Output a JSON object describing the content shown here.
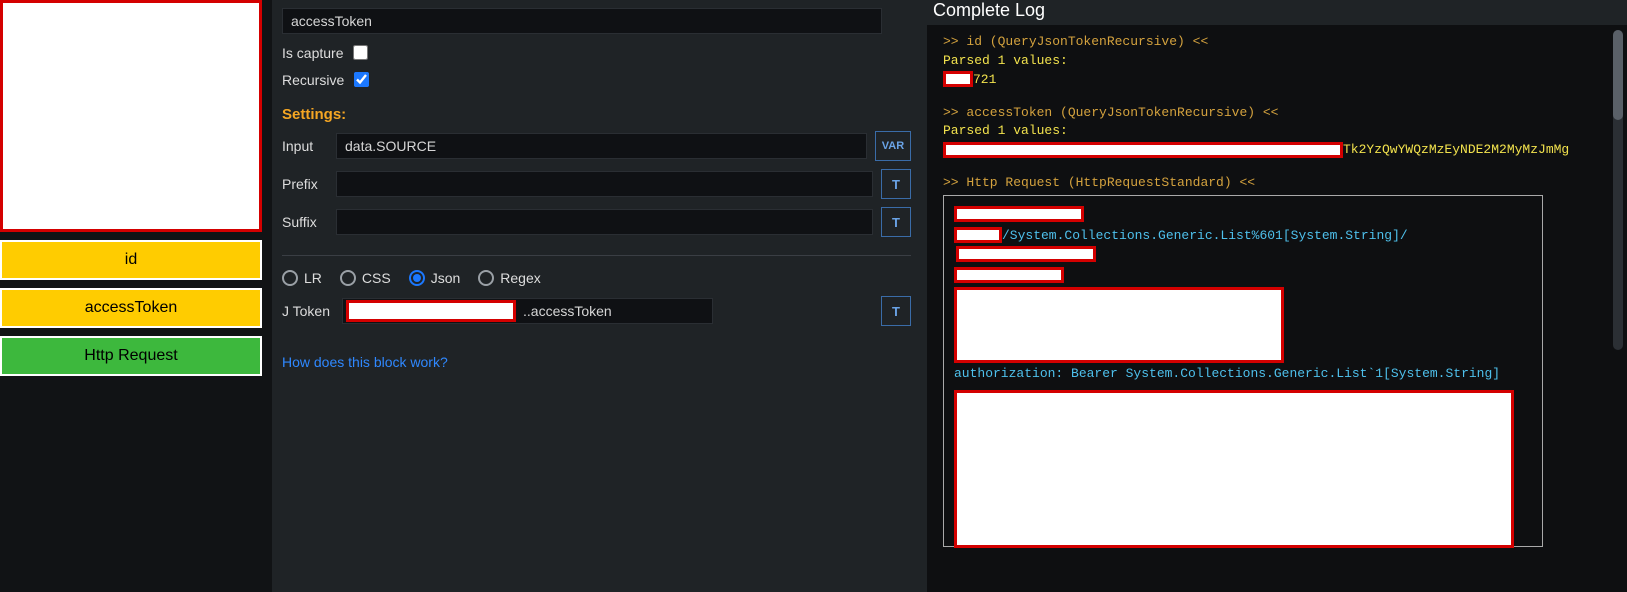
{
  "left": {
    "blocks": [
      "id",
      "accessToken",
      "Http Request"
    ]
  },
  "center": {
    "topField_value": "accessToken",
    "isCapture_label": "Is capture",
    "isCapture_checked": false,
    "recursive_label": "Recursive",
    "recursive_checked": true,
    "settings_header": "Settings:",
    "input_label": "Input",
    "input_value": "data.SOURCE",
    "prefix_label": "Prefix",
    "prefix_value": "",
    "suffix_label": "Suffix",
    "suffix_value": "",
    "var_btn": "VAR",
    "t_btn": "T",
    "parse_modes": [
      "LR",
      "CSS",
      "Json",
      "Regex"
    ],
    "parse_selected": "Json",
    "jtoken_label": "J Token",
    "jtoken_value_visible": "..accessToken",
    "help_link": "How does this block work?"
  },
  "right": {
    "title": "Complete Log",
    "lines": {
      "l1": ">> id (QueryJsonTokenRecursive) <<",
      "l2": "Parsed 1 values:",
      "l3_suffix": "721",
      "l4": ">> accessToken (QueryJsonTokenRecursive) <<",
      "l5": "Parsed 1 values:",
      "l6_suffix": "Tk2YzQwYWQzMzEyNDE2M2MyMzJmMg",
      "l7": ">> Http Request (HttpRequestStandard) <<",
      "http_path": "/System.Collections.Generic.List%601[System.String]/",
      "auth_line": "authorization: Bearer System.Collections.Generic.List`1[System.String]"
    }
  }
}
